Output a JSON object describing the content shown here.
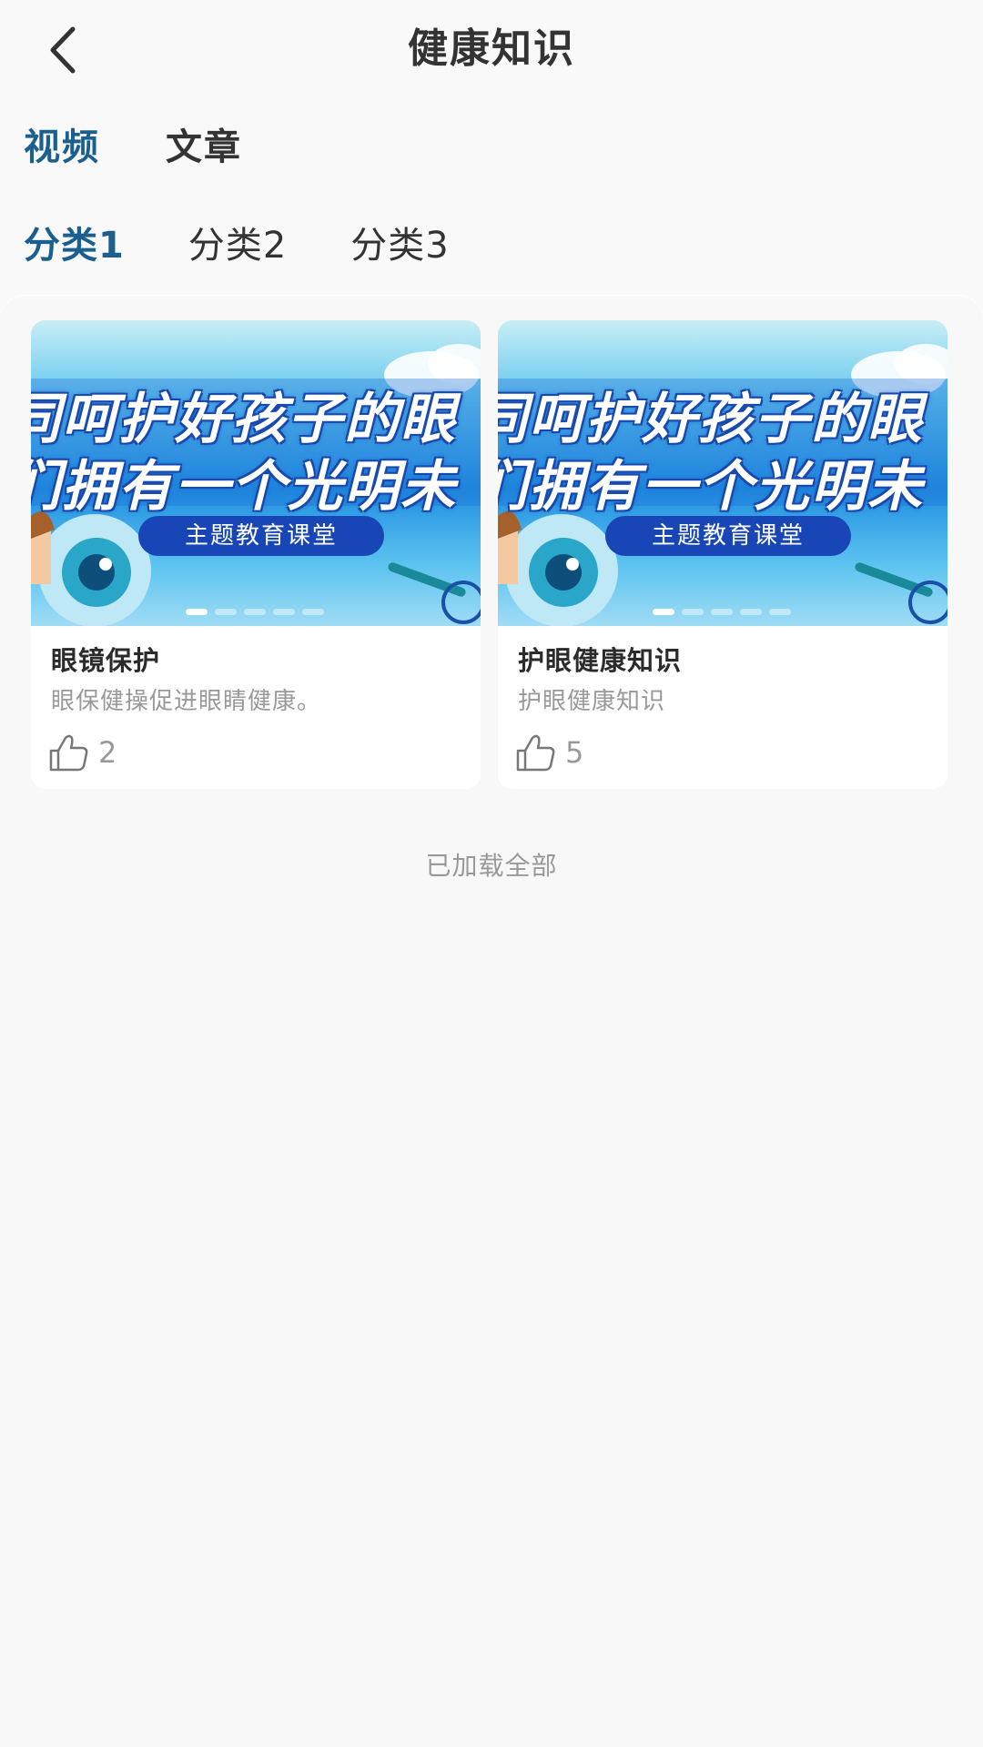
{
  "header": {
    "title": "健康知识"
  },
  "main_tabs": [
    {
      "label": "视频",
      "active": true
    },
    {
      "label": "文章",
      "active": false
    }
  ],
  "category_tabs": [
    {
      "label": "分类1",
      "active": true
    },
    {
      "label": "分类2",
      "active": false
    },
    {
      "label": "分类3",
      "active": false
    }
  ],
  "cards": [
    {
      "thumbnail": {
        "line1": "同呵护好孩子的眼",
        "line2": "们拥有一个光明未",
        "banner": "主题教育课堂"
      },
      "title": "眼镜保护",
      "description": "眼保健操促进眼睛健康。",
      "likes": "2"
    },
    {
      "thumbnail": {
        "line1": "同呵护好孩子的眼",
        "line2": "们拥有一个光明未",
        "banner": "主题教育课堂"
      },
      "title": "护眼健康知识",
      "description": "护眼健康知识",
      "likes": "5"
    }
  ],
  "footer": {
    "status": "已加载全部"
  },
  "colors": {
    "accent": "#1b5f8e",
    "text": "#333333",
    "muted": "#999999",
    "background": "#f9f9f9"
  },
  "icons": {
    "back": "chevron-left-icon",
    "like": "thumbs-up-icon"
  }
}
